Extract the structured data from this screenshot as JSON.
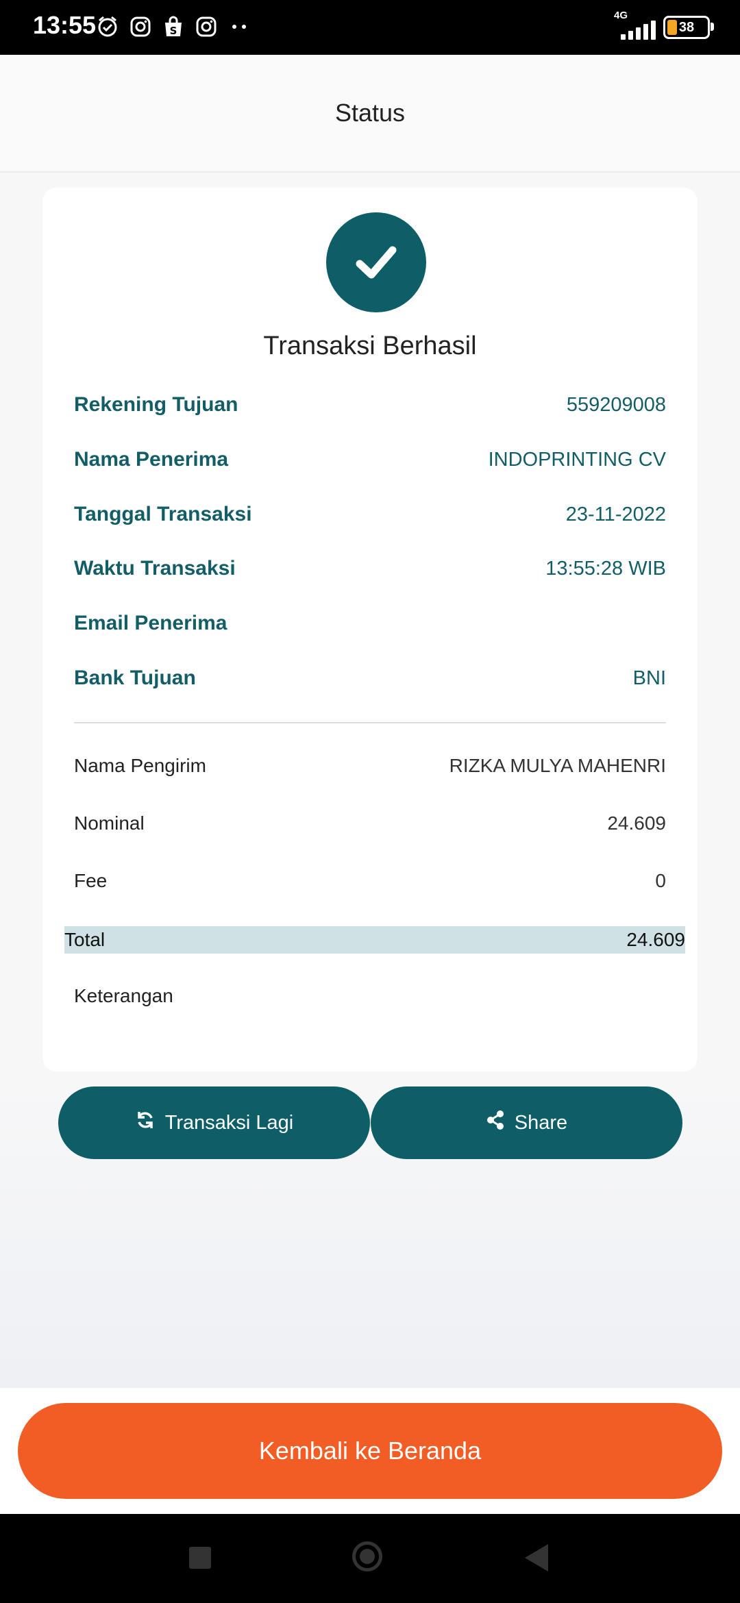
{
  "status_bar": {
    "time": "13:55",
    "network": "4G",
    "battery": "38"
  },
  "header": {
    "title": "Status"
  },
  "result": {
    "title": "Transaksi Berhasil",
    "icon": "check-circle-icon",
    "accent_color": "#0e5e68"
  },
  "recipient_details": [
    {
      "label": "Rekening Tujuan",
      "value": "559209008"
    },
    {
      "label": "Nama Penerima",
      "value": "INDOPRINTING CV"
    },
    {
      "label": "Tanggal Transaksi",
      "value": "23-11-2022"
    },
    {
      "label": "Waktu Transaksi",
      "value": "13:55:28 WIB"
    },
    {
      "label": "Email Penerima",
      "value": ""
    },
    {
      "label": "Bank Tujuan",
      "value": "BNI"
    }
  ],
  "payment_details": [
    {
      "label": "Nama Pengirim",
      "value": "RIZKA MULYA MAHENRI"
    },
    {
      "label": "Nominal",
      "value": "24.609"
    },
    {
      "label": "Fee",
      "value": "0"
    }
  ],
  "total": {
    "label": "Total",
    "value": "24.609"
  },
  "note": {
    "label": "Keterangan",
    "value": ""
  },
  "actions": {
    "again_label": "Transaksi Lagi",
    "share_label": "Share"
  },
  "home_button": {
    "label": "Kembali ke Beranda",
    "color": "#f15d24"
  }
}
